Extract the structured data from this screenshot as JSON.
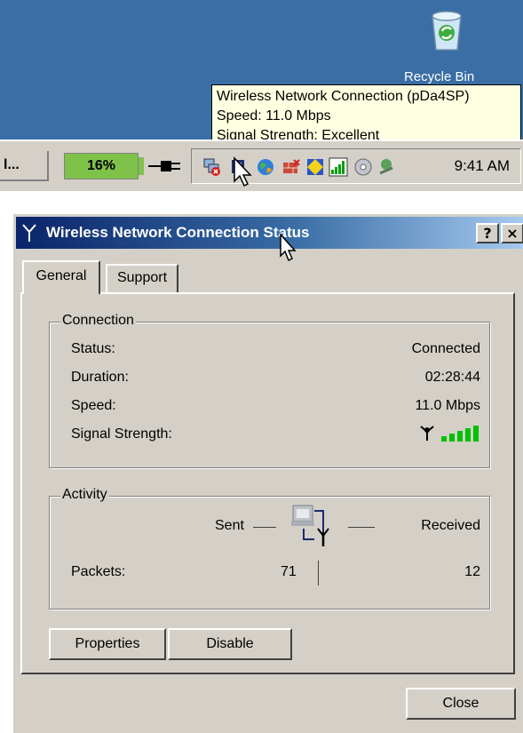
{
  "desktop": {
    "recycle_bin_label": "Recycle Bin"
  },
  "tooltip": {
    "lines": [
      "Wireless Network Connection (pDa4SP)",
      "Speed: 11.0 Mbps",
      "Signal Strength: Excellent"
    ]
  },
  "taskbar": {
    "task_button_label": "l...",
    "battery_label": "16%",
    "clock": "9:41 AM",
    "tray_icons": [
      "network-error-icon",
      "wireless-network-icon",
      "globe-icon",
      "firewall-icon",
      "shield-icon",
      "signal-bars-icon",
      "cd-icon",
      "connection-icon"
    ]
  },
  "dialog": {
    "title": "Wireless Network Connection Status",
    "help_button": "?",
    "close_button": "×",
    "tabs": [
      {
        "label": "General",
        "selected": true
      },
      {
        "label": "Support",
        "selected": false
      }
    ],
    "connection": {
      "group_title": "Connection",
      "rows": [
        {
          "label": "Status:",
          "value": "Connected"
        },
        {
          "label": "Duration:",
          "value": "02:28:44"
        },
        {
          "label": "Speed:",
          "value": "11.0 Mbps"
        },
        {
          "label": "Signal Strength:",
          "value": ""
        }
      ],
      "signal_bars_lit": 5
    },
    "activity": {
      "group_title": "Activity",
      "sent_label": "Sent",
      "received_label": "Received",
      "packets_label": "Packets:",
      "packets_sent": "71",
      "packets_received": "12"
    },
    "buttons": {
      "properties": "Properties",
      "disable": "Disable",
      "close": "Close"
    }
  },
  "colors": {
    "desktop": "#3a6ea5",
    "tooltip": "#ffffe1",
    "titlebar_start": "#0a246a",
    "titlebar_end": "#a6caf0",
    "face": "#d4d0c8",
    "battery": "#7fc24a",
    "signal_green": "#00c000"
  }
}
